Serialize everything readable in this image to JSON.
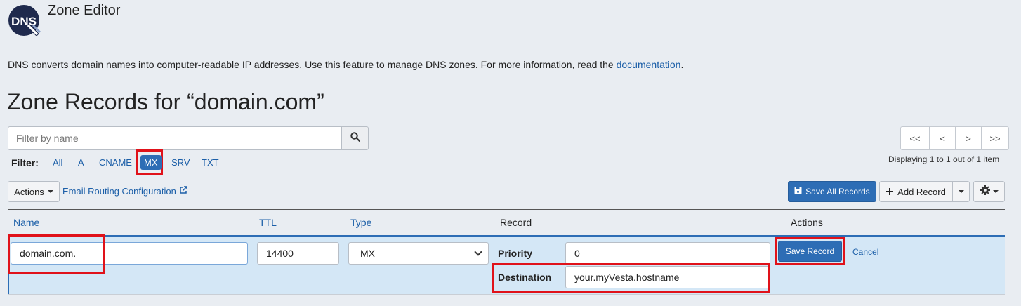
{
  "app": {
    "title": "Zone Editor",
    "logo_text": "DNS"
  },
  "intro": {
    "text": "DNS converts domain names into computer-readable IP addresses. Use this feature to manage DNS zones. For more information, read the ",
    "link": "documentation",
    "suffix": "."
  },
  "heading": "Zone Records for “domain.com”",
  "search": {
    "placeholder": "Filter by name",
    "icon": "search-icon"
  },
  "filter": {
    "label": "Filter:",
    "options": [
      "All",
      "A",
      "CNAME",
      "MX",
      "SRV",
      "TXT"
    ],
    "active": "MX"
  },
  "pager": {
    "first": "<<",
    "prev": "<",
    "next": ">",
    "last": ">>",
    "status": "Displaying 1 to 1 out of 1 item"
  },
  "toolbar": {
    "actions_label": "Actions",
    "email_routing_label": "Email Routing Configuration",
    "save_all_label": "Save All Records",
    "add_record_label": "Add Record"
  },
  "table": {
    "headers": {
      "name": "Name",
      "ttl": "TTL",
      "type": "Type",
      "record": "Record",
      "actions": "Actions"
    }
  },
  "edit_row": {
    "name_value": "domain.com.",
    "ttl_value": "14400",
    "type_value": "MX",
    "priority_label": "Priority",
    "priority_value": "0",
    "destination_label": "Destination",
    "destination_value": "your.myVesta.hostname",
    "save_label": "Save Record",
    "cancel_label": "Cancel"
  },
  "colors": {
    "accent": "#2d6db5",
    "link": "#1c5fa8",
    "highlight": "#e0121a",
    "row_bg": "#d4e7f6",
    "page_bg": "#e9edf2"
  }
}
